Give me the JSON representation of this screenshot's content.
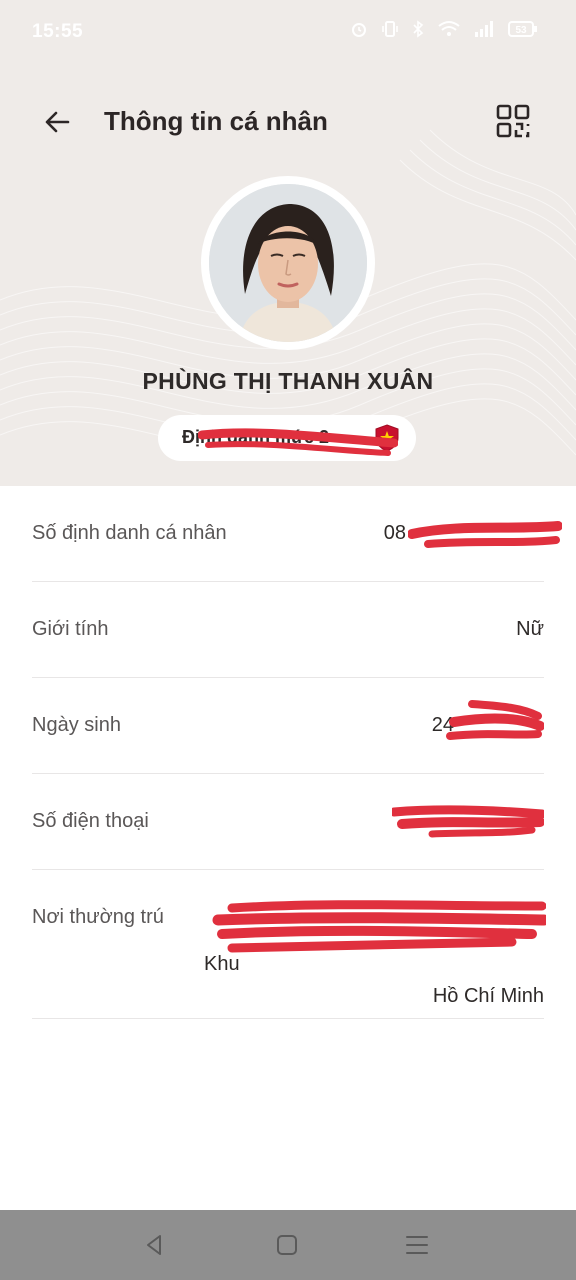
{
  "status_bar": {
    "time": "15:55",
    "icons": [
      "alarm-icon",
      "vibrate-icon",
      "bluetooth-icon",
      "wifi-icon",
      "signal-icon",
      "battery-icon"
    ],
    "battery_level": "53"
  },
  "header": {
    "title": "Thông tin cá nhân",
    "back_icon": "arrow-left-icon",
    "qr_icon": "qr-code-icon"
  },
  "profile": {
    "name": "PHÙNG THỊ THANH XUÂN",
    "id_chip_label": "Định danh mức 2"
  },
  "fields": [
    {
      "label": "Số định danh cá nhân",
      "value": "08"
    },
    {
      "label": "Giới tính",
      "value": "Nữ"
    },
    {
      "label": "Ngày sinh",
      "value": "24"
    },
    {
      "label": "Số điện thoại",
      "value": ""
    },
    {
      "label": "Nơi thường trú",
      "value_line2": "Khu",
      "value_line3": "Hồ Chí Minh"
    }
  ],
  "nav": {
    "icons": [
      "back-nav-icon",
      "home-nav-icon",
      "menu-nav-icon"
    ]
  },
  "colors": {
    "header_bg": "#efebe8",
    "redaction": "#e0303e",
    "nav_bg": "#8f8f8f"
  }
}
